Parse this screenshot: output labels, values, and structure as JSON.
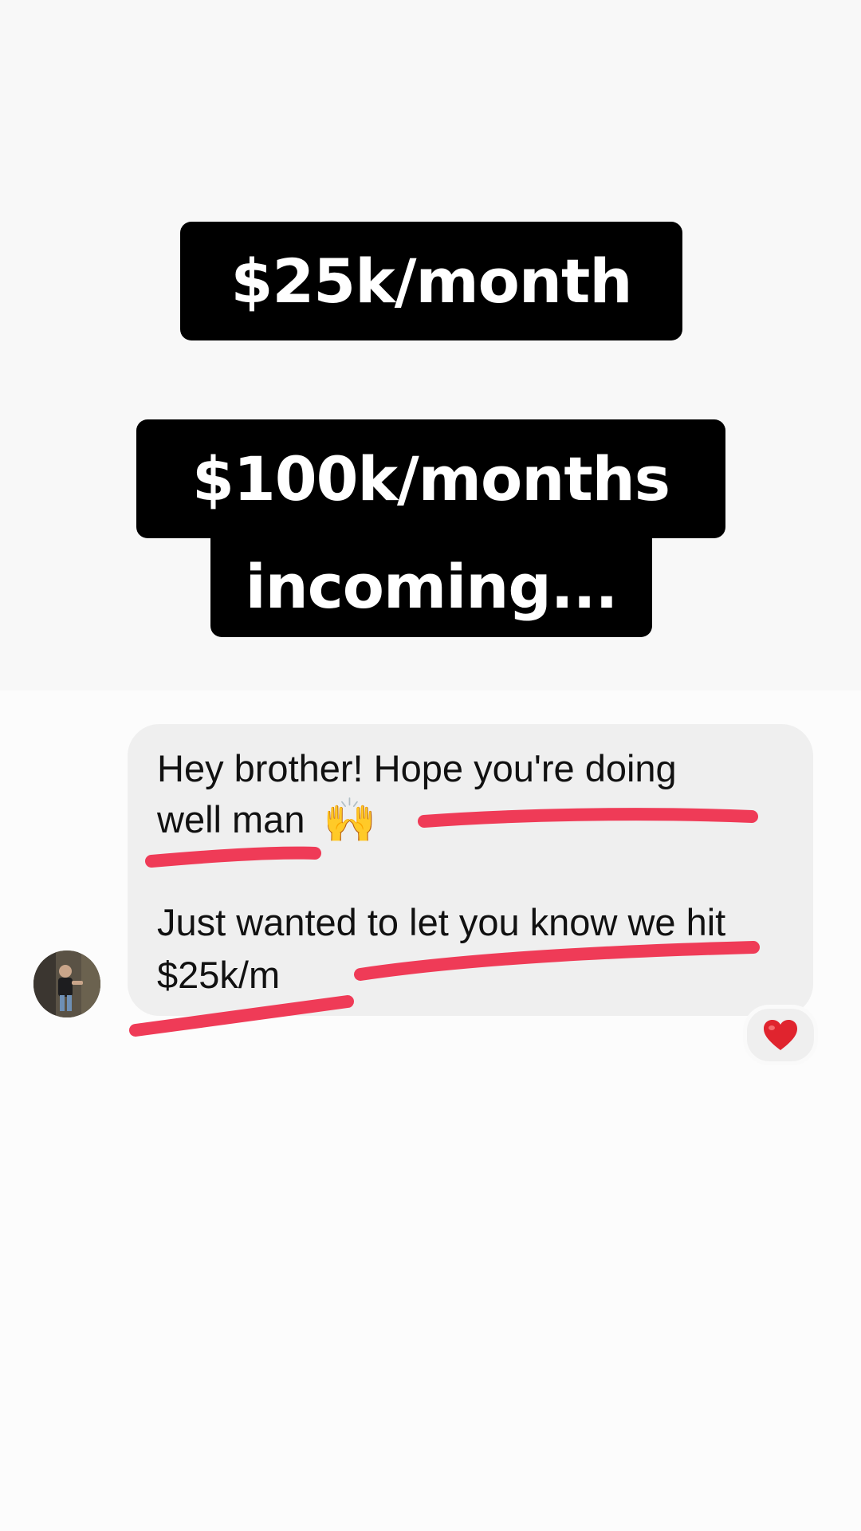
{
  "captions": {
    "line1": "$25k/month",
    "line2": "$100k/months",
    "line3": "incoming..."
  },
  "message": {
    "line1": "Hey brother! Hope you're doing",
    "line2": "well man",
    "emoji": "🙌",
    "line3": "Just wanted to let you know we hit",
    "line4": "$25k/m",
    "reaction": "❤️"
  },
  "colors": {
    "caption_bg": "#000000",
    "caption_text": "#ffffff",
    "bubble_bg": "#efefef",
    "underline": "#ef3b57",
    "heart": "#e0242e"
  },
  "icons": {
    "avatar": "profile-photo",
    "reaction": "heart-icon",
    "emoji": "raised-hands-icon"
  }
}
